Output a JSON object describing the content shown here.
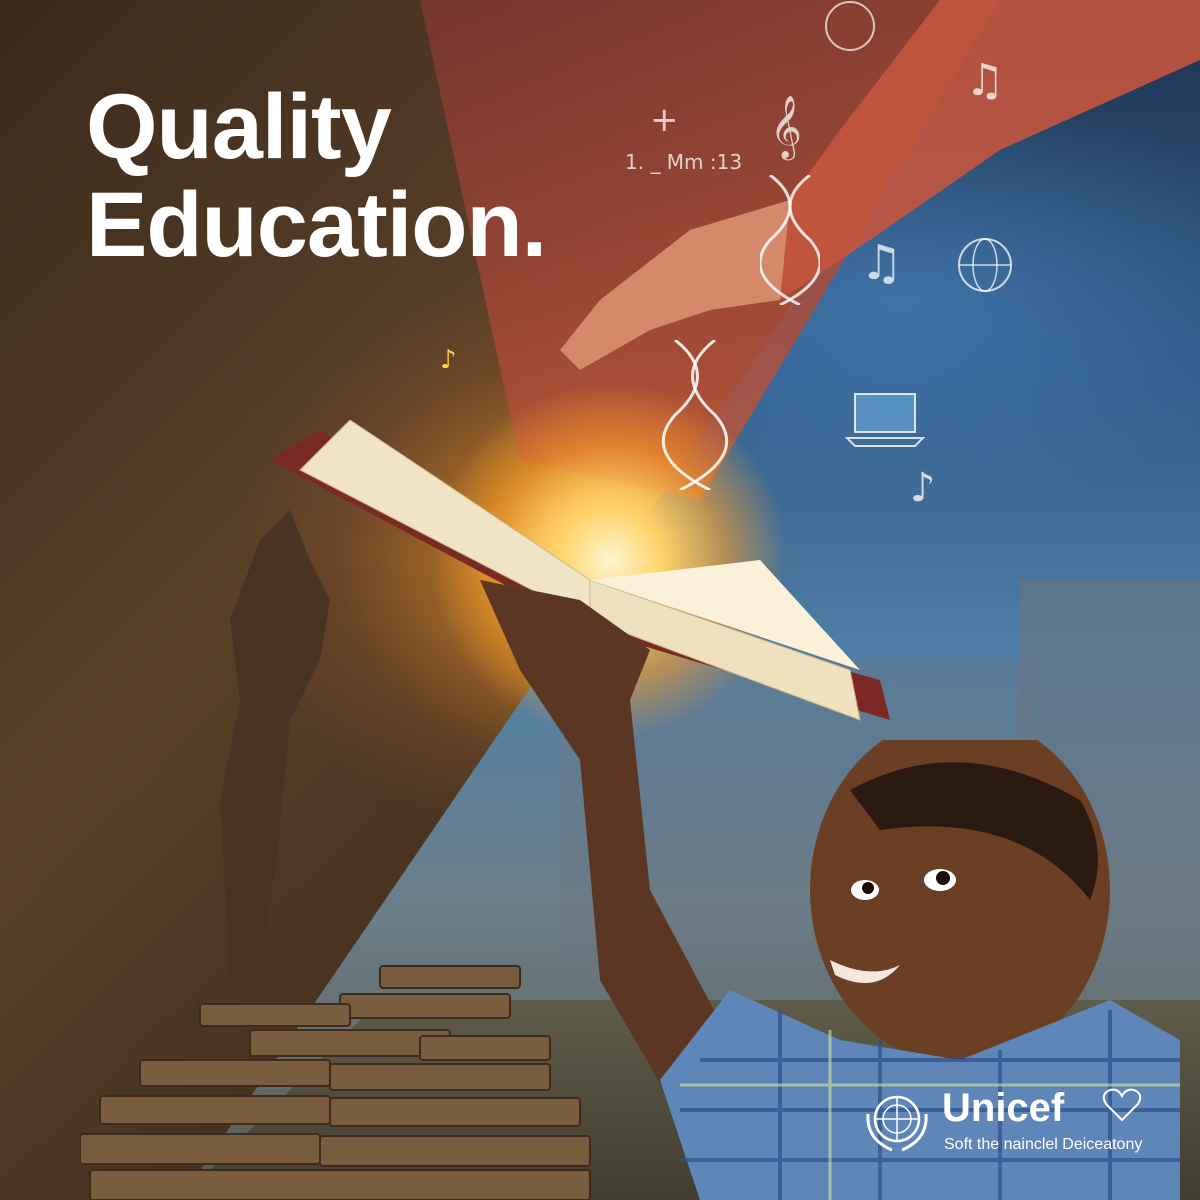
{
  "poster": {
    "headline_line1": "Quality",
    "headline_line2": "Education.",
    "org_name": "Unicef",
    "tagline": "Soft the nainclel Deiceatony",
    "doodle_text": "1. _ Mm :13"
  },
  "colors": {
    "headline": "#ffffff",
    "warm_glow": "#ffd36a",
    "sky_blue": "#2f5a86",
    "sepia": "#5a4028"
  },
  "icons": [
    "music-note-icon",
    "globe-icon",
    "dna-icon",
    "laptop-icon",
    "treble-clef-icon",
    "un-emblem-icon",
    "heart-hands-icon"
  ]
}
